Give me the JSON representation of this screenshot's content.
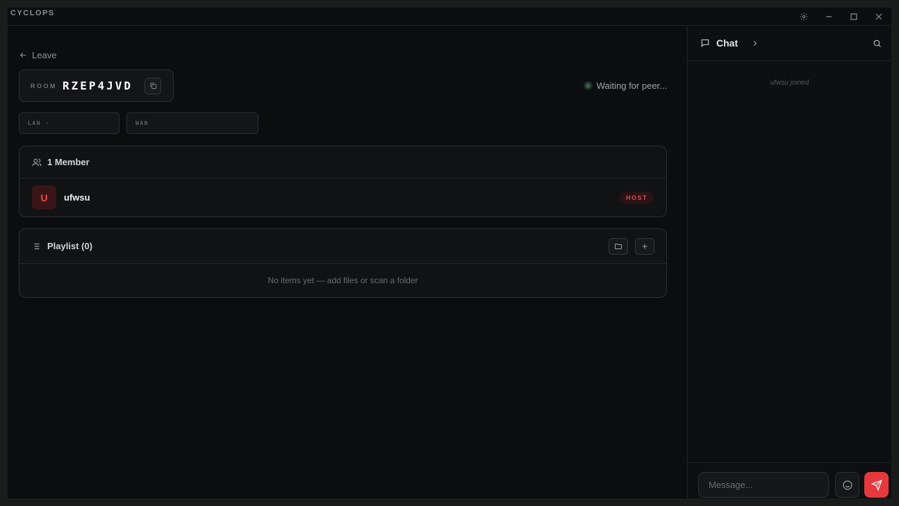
{
  "app": {
    "title": "CYCLOPS"
  },
  "nav": {
    "leave_label": "Leave"
  },
  "room": {
    "label": "ROOM",
    "code": "RZEP4JVD"
  },
  "status": {
    "text": "Waiting for peer..."
  },
  "addresses": {
    "lan_label": "LAN ·",
    "wan_label": "WAN"
  },
  "members": {
    "title": "1 Member",
    "list": [
      {
        "initial": "U",
        "name": "ufwsu",
        "badge": "HOST"
      }
    ]
  },
  "playlist": {
    "title": "Playlist (0)",
    "empty_text": "No items yet — add files or scan a folder"
  },
  "chat": {
    "title": "Chat",
    "messages": [
      {
        "type": "system",
        "text": "ufwsu joined"
      }
    ],
    "input_placeholder": "Message..."
  },
  "colors": {
    "accent": "#e5393d",
    "background": "#0c0d0f",
    "host_badge": "#e2494c"
  }
}
